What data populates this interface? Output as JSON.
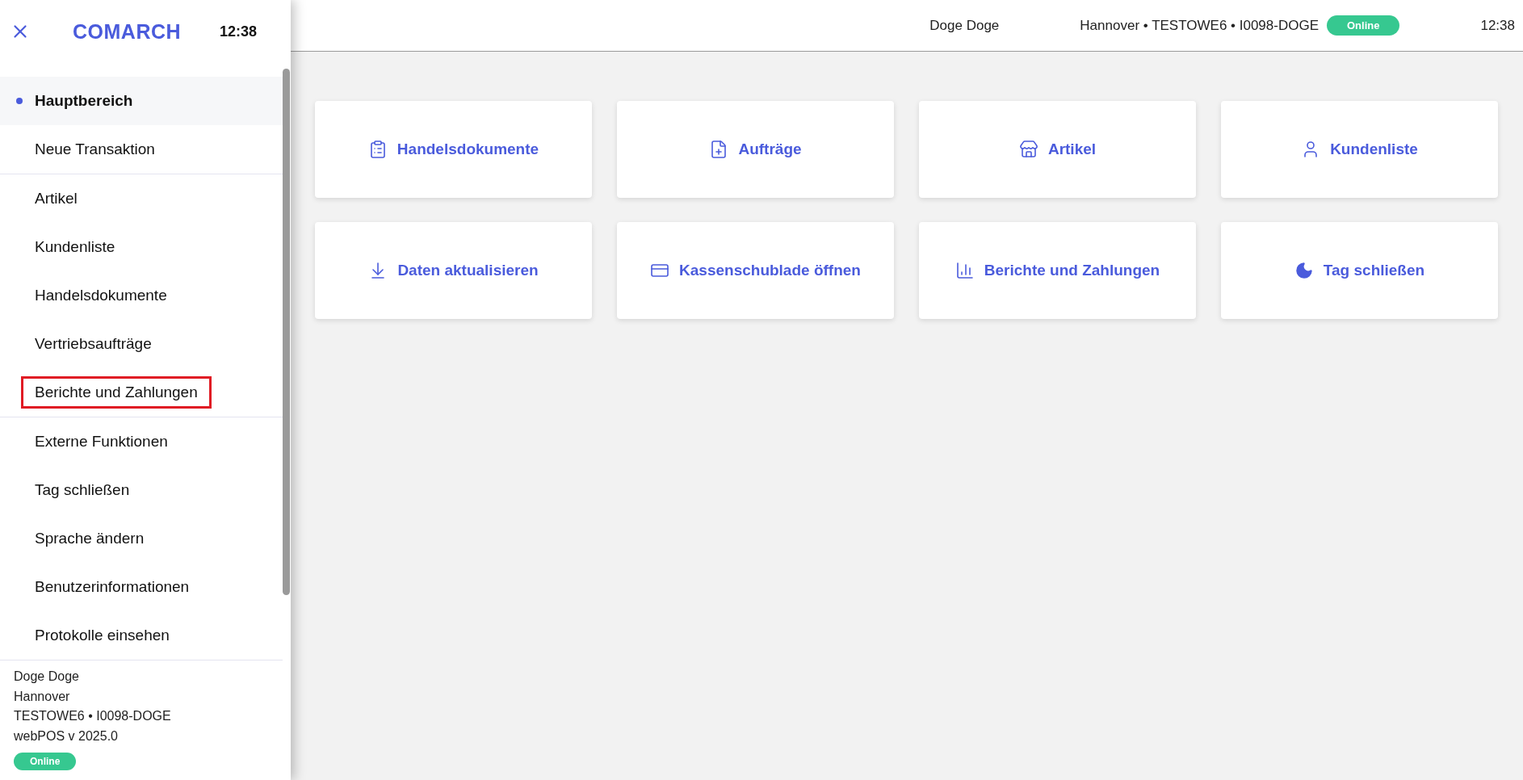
{
  "sidebar": {
    "brand": "COMARCH",
    "time": "12:38",
    "groups": [
      {
        "items": [
          {
            "label": "Hauptbereich",
            "selected": true,
            "highlighted": false
          },
          {
            "label": "Neue Transaktion",
            "selected": false,
            "highlighted": false
          }
        ]
      },
      {
        "items": [
          {
            "label": "Artikel",
            "selected": false,
            "highlighted": false
          },
          {
            "label": "Kundenliste",
            "selected": false,
            "highlighted": false
          },
          {
            "label": "Handelsdokumente",
            "selected": false,
            "highlighted": false
          },
          {
            "label": "Vertriebsaufträge",
            "selected": false,
            "highlighted": false
          },
          {
            "label": "Berichte und Zahlungen",
            "selected": false,
            "highlighted": true
          }
        ]
      },
      {
        "items": [
          {
            "label": "Externe Funktionen",
            "selected": false,
            "highlighted": false
          },
          {
            "label": "Tag schließen",
            "selected": false,
            "highlighted": false
          },
          {
            "label": "Sprache ändern",
            "selected": false,
            "highlighted": false
          },
          {
            "label": "Benutzerinformationen",
            "selected": false,
            "highlighted": false
          },
          {
            "label": "Protokolle einsehen",
            "selected": false,
            "highlighted": false
          }
        ]
      }
    ],
    "footer": {
      "lines": [
        "Doge Doge",
        "Hannover",
        "TESTOWE6 • I0098-DOGE",
        "webPOS v 2025.0"
      ],
      "status": "Online"
    }
  },
  "header": {
    "user": "Doge Doge",
    "location": "Hannover • TESTOWE6 • I0098-DOGE",
    "status": "Online",
    "time": "12:38"
  },
  "tiles": [
    {
      "label": "Handelsdokumente",
      "kind": "list"
    },
    {
      "label": "Aufträge",
      "kind": "order"
    },
    {
      "label": "Artikel",
      "kind": "store"
    },
    {
      "label": "Kundenliste",
      "kind": "user"
    },
    {
      "label": "Daten aktualisieren",
      "kind": "download"
    },
    {
      "label": "Kassenschublade öffnen",
      "kind": "card"
    },
    {
      "label": "Berichte und Zahlungen",
      "kind": "chart"
    },
    {
      "label": "Tag schließen",
      "kind": "moon"
    }
  ]
}
